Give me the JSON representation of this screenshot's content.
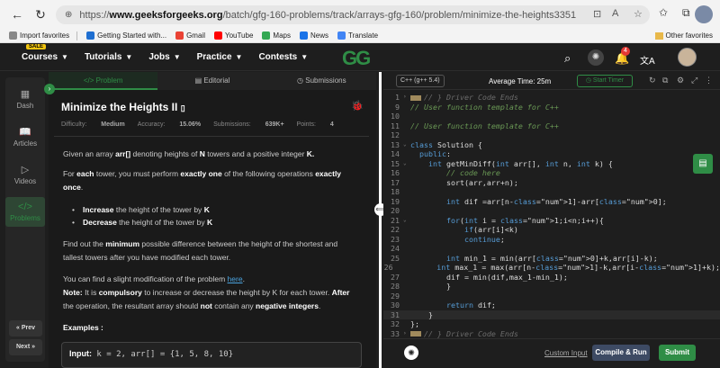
{
  "browser": {
    "url_prefix": "https://",
    "url_host": "www.geeksforgeeks.org",
    "url_path": "/batch/gfg-160-problems/track/arrays-gfg-160/problem/minimize-the-heights3351",
    "bookmarks": [
      {
        "label": "Import favorites",
        "color": "#888888"
      },
      {
        "label": "Getting Started with...",
        "color": "#1f6fd1"
      },
      {
        "label": "Gmail",
        "color": "#ea4335"
      },
      {
        "label": "YouTube",
        "color": "#ff0000"
      },
      {
        "label": "Maps",
        "color": "#34a853"
      },
      {
        "label": "News",
        "color": "#1a73e8"
      },
      {
        "label": "Translate",
        "color": "#4285f4"
      }
    ],
    "other_favorites": "Other favorites"
  },
  "header": {
    "sale_badge": "SALE",
    "menus": [
      "Courses",
      "Tutorials",
      "Jobs",
      "Practice",
      "Contests"
    ],
    "logo": "GG",
    "notification_count": "4"
  },
  "rail": {
    "items": [
      "Dash",
      "Articles",
      "Videos",
      "Problems"
    ],
    "prev": "« Prev",
    "next": "Next »"
  },
  "problem": {
    "tabs": [
      "Problem",
      "Editorial",
      "Submissions"
    ],
    "title": "Minimize the Heights II",
    "difficulty_label": "Difficulty:",
    "difficulty": "Medium",
    "accuracy_label": "Accuracy:",
    "accuracy": "15.06%",
    "submissions_label": "Submissions:",
    "submissions": "639K+",
    "points_label": "Points:",
    "points": "4",
    "p1_a": "Given an array ",
    "p1_b": "arr[]",
    "p1_c": " denoting heights of ",
    "p1_d": "N",
    "p1_e": " towers and a positive integer ",
    "p1_f": "K.",
    "p2_a": "For ",
    "p2_b": "each",
    "p2_c": " tower, you must perform ",
    "p2_d": "exactly one",
    "p2_e": " of the following operations ",
    "p2_f": "exactly once",
    "p2_g": ".",
    "b1_a": "Increase",
    "b1_b": " the height of the tower by ",
    "b1_c": "K",
    "b2_a": "Decrease",
    "b2_b": " the height of the tower by ",
    "b2_c": "K",
    "p3_a": "Find out the ",
    "p3_b": "minimum",
    "p3_c": " possible difference between the height of the shortest and tallest towers after you have modified each tower.",
    "p4_a": "You can find a slight modification of the problem ",
    "p4_link": "here",
    "p4_b": ".",
    "p5_a": "Note:",
    "p5_b": " It is ",
    "p5_c": "compulsory",
    "p5_d": " to increase or decrease the height by K for each tower. ",
    "p5_e": "After",
    "p5_f": " the operation, the resultant array should ",
    "p5_g": "not",
    "p5_h": " contain any ",
    "p5_i": "negative integers",
    "p5_j": ".",
    "examples_label": "Examples :",
    "example_input_label": "Input:",
    "example_input": " k = 2, arr[] = {1, 5, 8, 10}"
  },
  "editor": {
    "language": "C++ (g++ 5.4)",
    "avg_time": "Average Time: 25m",
    "start_timer": "Start Timer",
    "lines": [
      {
        "n": "1",
        "fold": "›",
        "type": "coll",
        "text": "// } Driver Code Ends"
      },
      {
        "n": "9",
        "fold": "",
        "type": "cm",
        "text": "// User function template for C++"
      },
      {
        "n": "10",
        "fold": "",
        "type": "plain",
        "text": ""
      },
      {
        "n": "11",
        "fold": "",
        "type": "cm",
        "text": "// User function template for C++"
      },
      {
        "n": "12",
        "fold": "",
        "type": "plain",
        "text": ""
      },
      {
        "n": "13",
        "fold": "⌄",
        "type": "plain",
        "text": "class Solution {"
      },
      {
        "n": "14",
        "fold": "",
        "type": "plain",
        "text": "  public:"
      },
      {
        "n": "15",
        "fold": "⌄",
        "type": "plain",
        "text": "    int getMinDiff(int arr[], int n, int k) {"
      },
      {
        "n": "16",
        "fold": "",
        "type": "cm",
        "text": "        // code here"
      },
      {
        "n": "17",
        "fold": "",
        "type": "plain",
        "text": "        sort(arr,arr+n);"
      },
      {
        "n": "18",
        "fold": "",
        "type": "plain",
        "text": ""
      },
      {
        "n": "19",
        "fold": "",
        "type": "plain",
        "text": "        int dif =arr[n-1]-arr[0];"
      },
      {
        "n": "20",
        "fold": "",
        "type": "plain",
        "text": ""
      },
      {
        "n": "21",
        "fold": "⌄",
        "type": "plain",
        "text": "        for(int i = 1;i<n;i++){"
      },
      {
        "n": "22",
        "fold": "",
        "type": "plain",
        "text": "            if(arr[i]<k)"
      },
      {
        "n": "23",
        "fold": "",
        "type": "plain",
        "text": "            continue;"
      },
      {
        "n": "24",
        "fold": "",
        "type": "plain",
        "text": ""
      },
      {
        "n": "25",
        "fold": "",
        "type": "plain",
        "text": "        int min_1 = min(arr[0]+k,arr[i]-k);"
      },
      {
        "n": "26",
        "fold": "",
        "type": "plain",
        "text": "        int max_1 = max(arr[n-1]-k,arr[i-1]+k);"
      },
      {
        "n": "27",
        "fold": "",
        "type": "plain",
        "text": "        dif = min(dif,max_1-min_1);"
      },
      {
        "n": "28",
        "fold": "",
        "type": "plain",
        "text": "        }"
      },
      {
        "n": "29",
        "fold": "",
        "type": "plain",
        "text": ""
      },
      {
        "n": "30",
        "fold": "",
        "type": "plain",
        "text": "        return dif;"
      },
      {
        "n": "31",
        "fold": "",
        "type": "cur",
        "text": "    }"
      },
      {
        "n": "32",
        "fold": "",
        "type": "plain",
        "text": "};"
      },
      {
        "n": "33",
        "fold": "›",
        "type": "coll",
        "text": "// } Driver Code Ends"
      }
    ],
    "custom_input": "Custom Input",
    "compile_run": "Compile & Run",
    "submit": "Submit"
  }
}
